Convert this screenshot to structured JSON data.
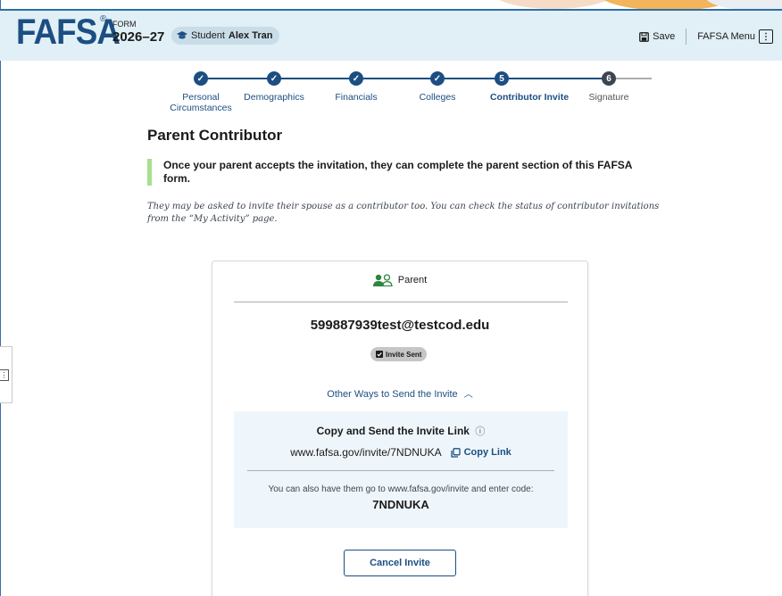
{
  "header": {
    "logo": "FAFSA",
    "registered": "®",
    "form_label": "FORM",
    "form_year": "2026–27",
    "student_label": "Student",
    "student_name": "Alex Tran",
    "save_label": "Save",
    "menu_label": "FAFSA Menu"
  },
  "stepper": {
    "steps": [
      {
        "label": "Personal Circumstances",
        "state": "complete"
      },
      {
        "label": "Demographics",
        "state": "complete"
      },
      {
        "label": "Financials",
        "state": "complete"
      },
      {
        "label": "Colleges",
        "state": "complete"
      },
      {
        "label": "Contributor Invite",
        "state": "current",
        "number": "5"
      },
      {
        "label": "Signature",
        "state": "future",
        "number": "6"
      }
    ]
  },
  "page": {
    "title": "Parent Contributor",
    "callout": "Once your parent accepts the invitation, they can complete the parent section of this FAFSA form.",
    "note": "They may be asked to invite their spouse as a contributor too. You can check the status of contributor invitations from the “My Activity” page."
  },
  "card": {
    "role": "Parent",
    "email": "599887939test@testcod.edu",
    "status_badge": "Invite Sent",
    "other_ways": "Other Ways to Send the Invite",
    "copy_title": "Copy and Send the Invite Link",
    "invite_url": "www.fafsa.gov/invite/7NDNUKA",
    "copy_link_label": "Copy Link",
    "alt_instructions": "You can also have them go to www.fafsa.gov/invite and enter code:",
    "code": "7NDNUKA",
    "cancel_label": "Cancel Invite"
  },
  "colors": {
    "brand": "#1c4e82",
    "header_bg": "#e1eff6",
    "callout_border": "#a6e08f",
    "panel_bg": "#eff6fb",
    "icon_green": "#2e8540"
  }
}
